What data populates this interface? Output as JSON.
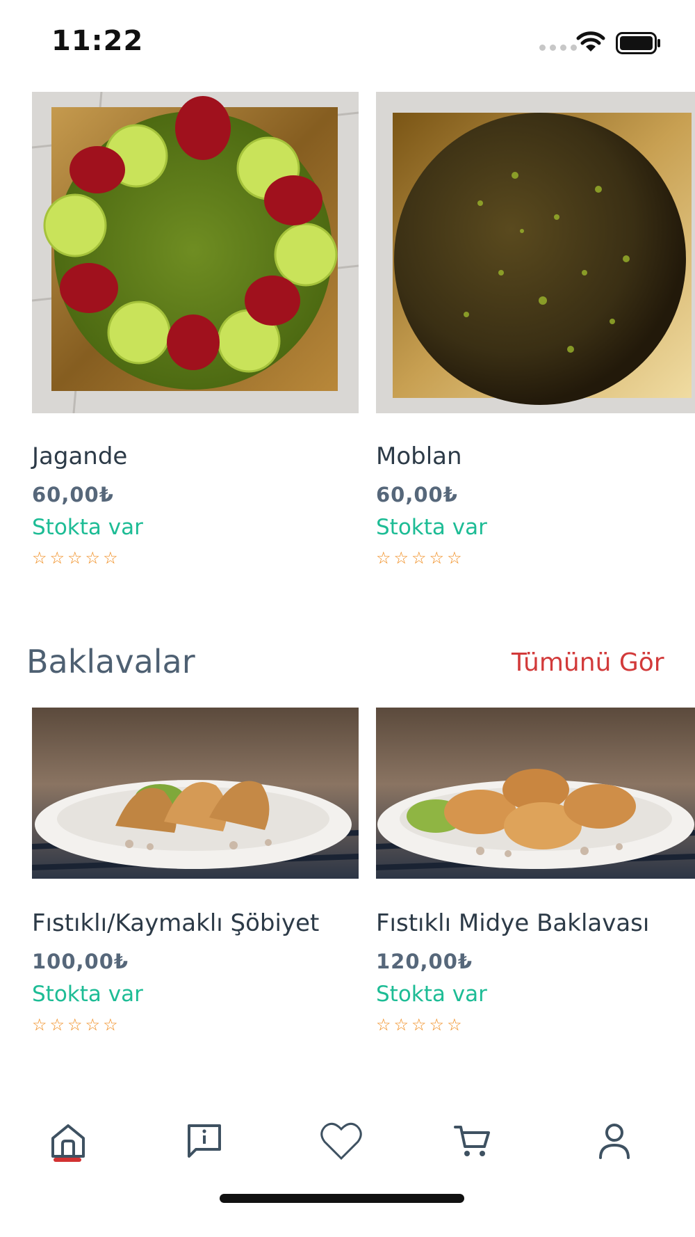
{
  "status_bar": {
    "time": "11:22"
  },
  "products_top": [
    {
      "name": "Jagande",
      "price": "60,00₺",
      "stock": "Stokta var",
      "rating": 0
    },
    {
      "name": "Moblan",
      "price": "60,00₺",
      "stock": "Stokta var",
      "rating": 0
    }
  ],
  "section": {
    "title": "Baklavalar",
    "see_all": "Tümünü Gör"
  },
  "products_bottom": [
    {
      "name": "Fıstıklı/Kaymaklı Şöbiyet",
      "price": "100,00₺",
      "stock": "Stokta var",
      "rating": 0
    },
    {
      "name": "Fıstıklı Midye Baklavası",
      "price": "120,00₺",
      "stock": "Stokta var",
      "rating": 0
    }
  ],
  "star_glyph": "☆",
  "tabbar": {
    "items": [
      "home-icon",
      "message-alert-icon",
      "heart-icon",
      "cart-icon",
      "profile-icon"
    ],
    "active": "home-icon"
  },
  "colors": {
    "accent": "#d23232",
    "stock_green": "#1dbc95",
    "star_orange": "#f08a1a",
    "title_slate": "#4e6072"
  }
}
